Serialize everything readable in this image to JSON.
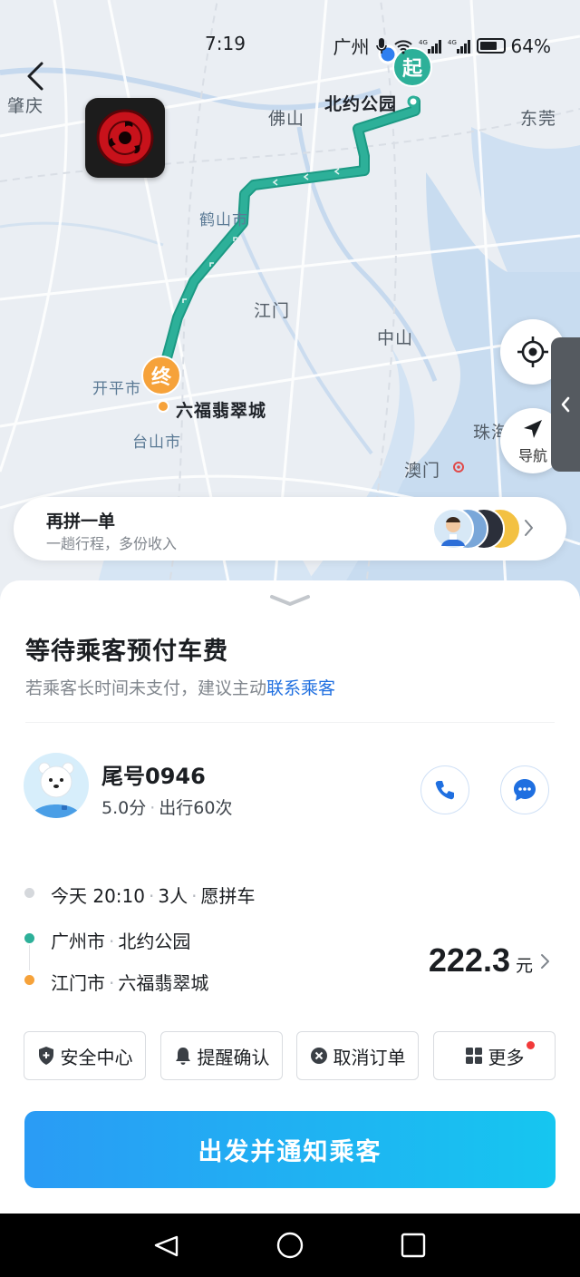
{
  "status_bar": {
    "time": "7:19",
    "carrier": "广州",
    "battery": "64%",
    "network": "4G"
  },
  "map": {
    "labels": {
      "zhaoqing": "肇庆",
      "foshan": "佛山",
      "dongguan": "东莞",
      "heshan": "鹤山市",
      "jiangmen": "江门",
      "zhongshan": "中山",
      "kaiping": "开平市",
      "taishan": "台山市",
      "zhuhai": "珠海",
      "macau": "澳门"
    },
    "start_marker": "起",
    "start_name": "北约公园",
    "end_marker": "终",
    "end_name": "六福翡翠城",
    "nav_label": "导航",
    "route_color": "#2db099"
  },
  "carpool": {
    "title": "再拼一单",
    "subtitle": "一趟行程，多份收入"
  },
  "sheet": {
    "title": "等待乘客预付车费",
    "subtitle_prefix": "若乘客长时间未支付，建议主动",
    "subtitle_link": "联系乘客",
    "passenger": {
      "name": "尾号0946",
      "rating": "5.0分",
      "trips": "出行60次"
    },
    "trip": {
      "time": "今天 20:10",
      "people": "3人",
      "mode": "愿拼车",
      "origin_city": "广州市",
      "origin_place": "北约公园",
      "dest_city": "江门市",
      "dest_place": "六福翡翠城",
      "price": "222.3",
      "price_unit": "元"
    },
    "actions": {
      "safety": "安全中心",
      "remind": "提醒确认",
      "cancel": "取消订单",
      "more": "更多"
    },
    "primary": "出发并通知乘客"
  },
  "colors": {
    "accent_blue": "#1f6fe0",
    "start_green": "#2db099",
    "end_orange": "#f6a23a",
    "button_gradient_start": "#2a9bf5",
    "button_gradient_end": "#16c6f0"
  }
}
